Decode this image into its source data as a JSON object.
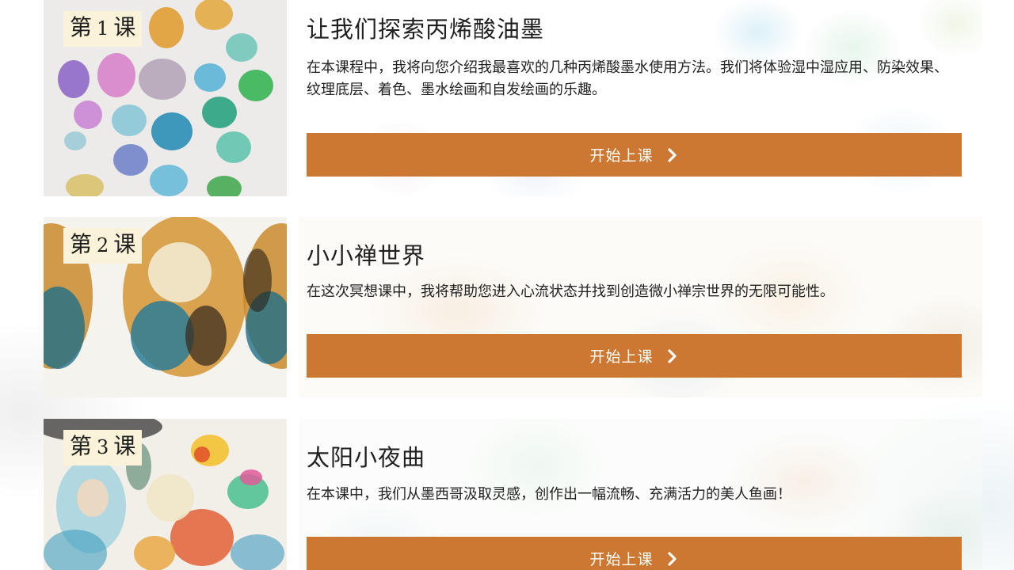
{
  "lessons": [
    {
      "badge_prefix": "第",
      "badge_number": "1",
      "badge_suffix": "课",
      "title": "让我们探索丙烯酸油墨",
      "description": "在本课程中，我将向您介绍我最喜欢的几种丙烯酸墨水使用方法。我们将体验湿中湿应用、防染效果、纹理底层、着色、墨水绘画和自发绘画的乐趣。",
      "button_label": "开始上课"
    },
    {
      "badge_prefix": "第",
      "badge_number": "2",
      "badge_suffix": "课",
      "title": "小小禅世界",
      "description": "在这次冥想课中，我将帮助您进入心流状态并找到创造微小禅宗世界的无限可能性。",
      "button_label": "开始上课"
    },
    {
      "badge_prefix": "第",
      "badge_number": "3",
      "badge_suffix": "课",
      "title": "太阳小夜曲",
      "description": "在本课中，我们从墨西哥汲取灵感，创作出一幅流畅、充满活力的美人鱼画！",
      "button_label": "开始上课"
    }
  ],
  "colors": {
    "button": "#cc7832",
    "badge_bg": "#fbf3d9",
    "text": "#222222"
  },
  "icons": {
    "button_icon": "chevron-right-icon"
  }
}
